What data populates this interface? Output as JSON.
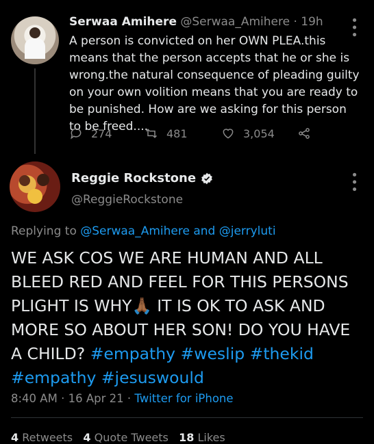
{
  "parent_tweet": {
    "author_name": "Serwaa Amihere",
    "author_handle": "@Serwaa_Amihere",
    "separator": "·",
    "time": "19h",
    "text": "A person is convicted on her OWN PLEA.this means that the person accepts that he or she is wrong.the natural consequence of pleading guilty on your own volition means that you are ready to be punished. How are we  asking for this  person to be freed....",
    "reply_count": "274",
    "retweet_count": "481",
    "like_count": "3,054"
  },
  "main_tweet": {
    "author_name": "Reggie Rockstone",
    "author_handle": "@ReggieRockstone",
    "replying_prefix": "Replying to",
    "replying_user1": "@Serwaa_Amihere",
    "replying_and": "and",
    "replying_user2": "@jerryluti",
    "text_part1": "WE ASK COS WE ARE HUMAN AND ALL BLEED RED AND FEEL FOR THIS PERSONS PLIGHT IS WHY",
    "emoji": "🙏🏾",
    "text_part2": " IT IS OK TO ASK AND MORE SO ABOUT HER SON! DO YOU HAVE A CHILD? ",
    "hashtags": [
      "#empathy",
      "#weslip",
      "#thekid",
      "#empathy",
      "#jesuswould"
    ],
    "time": "8:40 AM",
    "date": "16 Apr 21",
    "source": "Twitter for iPhone",
    "dot": "·"
  },
  "stats": {
    "retweets_count": "4",
    "retweets_label": "Retweets",
    "quotes_count": "4",
    "quotes_label": "Quote Tweets",
    "likes_count": "18",
    "likes_label": "Likes"
  },
  "colors": {
    "background": "#000000",
    "link": "#1d9bf0",
    "muted": "#8b8b8b",
    "text": "#e7e9ea"
  },
  "icons": [
    "reply-icon",
    "retweet-icon",
    "like-icon",
    "share-icon",
    "verified-icon",
    "more-icon"
  ]
}
